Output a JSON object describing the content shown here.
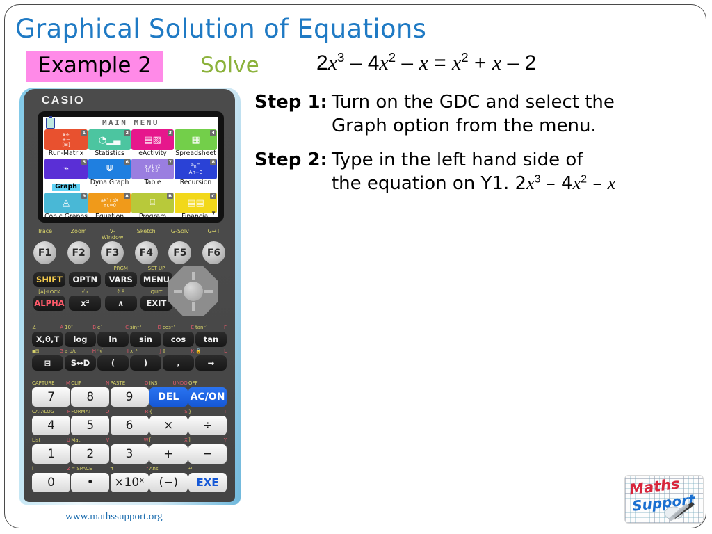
{
  "slide": {
    "title": "Graphical Solution of Equations",
    "example_badge": "Example 2",
    "solve_label": "Solve",
    "website": "www.mathssupport.org",
    "accent_blue": "#1F7AC4",
    "badge_pink": "#FF8AE8",
    "solve_green": "#8CB23C"
  },
  "equation": {
    "full": "2x³ – 4x² – x = x² + x – 2",
    "lhs": "2x³ – 4x² – x",
    "rhs": "x² + x – 2"
  },
  "steps": [
    {
      "key": "Step 1:",
      "line1": "Turn on the GDC and select the",
      "line2": "Graph option from the menu."
    },
    {
      "key": "Step 2:",
      "line1": "Type in the left hand side of",
      "line2": "the equation on Y1. 2x³ – 4x² – x"
    }
  ],
  "calculator": {
    "brand": "CASIO",
    "screen": {
      "title": "MAIN MENU",
      "battery_icon": "battery-icon",
      "scroll_arrow": "▼",
      "menu_items": [
        {
          "num": "1",
          "label": "Run-Matrix",
          "color": "#e8512f",
          "icon": "matrix-icon",
          "selected": false
        },
        {
          "num": "2",
          "label": "Statistics",
          "color": "#4cc5a0",
          "icon": "statistics-icon",
          "selected": false
        },
        {
          "num": "3",
          "label": "eActivity",
          "color": "#e6178c",
          "icon": "eactivity-icon",
          "selected": false
        },
        {
          "num": "4",
          "label": "Spreadsheet",
          "color": "#73cf4a",
          "icon": "spreadsheet-icon",
          "selected": false
        },
        {
          "num": "5",
          "label": "Graph",
          "color": "#5a2fd6",
          "icon": "graph-icon",
          "selected": true
        },
        {
          "num": "6",
          "label": "Dyna Graph",
          "color": "#1f7fe0",
          "icon": "dyna-graph-icon",
          "selected": false
        },
        {
          "num": "7",
          "label": "Table",
          "color": "#9a7ee0",
          "icon": "table-icon",
          "selected": false
        },
        {
          "num": "8",
          "label": "Recursion",
          "color": "#2a42d6",
          "icon": "recursion-icon",
          "selected": false
        },
        {
          "num": "9",
          "label": "Conic Graphs",
          "color": "#49b8d6",
          "icon": "conic-icon",
          "selected": false
        },
        {
          "num": "A",
          "label": "Equation",
          "color": "#f09a1a",
          "icon": "equation-icon",
          "selected": false
        },
        {
          "num": "B",
          "label": "Program",
          "color": "#b8c93a",
          "icon": "program-icon",
          "selected": false
        },
        {
          "num": "C",
          "label": "Financial",
          "color": "#f2d81a",
          "icon": "financial-icon",
          "selected": false
        }
      ],
      "tile_glyphs": {
        "matrix": "×÷\n+−",
        "statistics": "◔",
        "eactivity": "▤",
        "spreadsheet": "▦",
        "graph": "∿",
        "dyna_graph": "⋓",
        "table": "⌗",
        "recursion": "an=\nAn+B",
        "conic": "◬",
        "equation": "aX²+bX\n+c=0",
        "program": "⛭",
        "financial": "💵"
      }
    },
    "fkeys": [
      {
        "label": "Trace",
        "key": "F1"
      },
      {
        "label": "Zoom",
        "key": "F2"
      },
      {
        "label": "V-Window",
        "key": "F3"
      },
      {
        "label": "Sketch",
        "key": "F4"
      },
      {
        "label": "G-Solv",
        "key": "F5"
      },
      {
        "label": "G↔T",
        "key": "F6"
      }
    ],
    "row_shift": [
      {
        "top": "",
        "key": "SHIFT"
      },
      {
        "top": "",
        "key": "OPTN"
      },
      {
        "top": "PRGM",
        "key": "VARS"
      },
      {
        "top": "SET UP",
        "key": "MENU"
      }
    ],
    "row_alpha": [
      {
        "top": "[A]-LOCK",
        "key": "ALPHA"
      },
      {
        "top": "√  r",
        "key": "x²"
      },
      {
        "top": "∛  θ",
        "key": "∧"
      },
      {
        "top": "QUIT",
        "key": "EXIT"
      }
    ],
    "row_trig": [
      {
        "tl": "∠",
        "tr": "A",
        "key": "X,θ,T"
      },
      {
        "tl": "10ˣ",
        "tr": "B",
        "key": "log"
      },
      {
        "tl": "e˟",
        "tr": "C",
        "key": "ln"
      },
      {
        "tl": "sin⁻¹",
        "tr": "D",
        "key": "sin"
      },
      {
        "tl": "cos⁻¹",
        "tr": "E",
        "key": "cos"
      },
      {
        "tl": "tan⁻¹",
        "tr": "F",
        "key": "tan"
      }
    ],
    "row_frac": [
      {
        "tl": "▪⊟",
        "tr": "G",
        "key": "⊟"
      },
      {
        "tl": "a b/c",
        "tr": "H",
        "key": "S↔D"
      },
      {
        "tl": "ˣ√",
        "tr": "I",
        "key": "("
      },
      {
        "tl": "x⁻¹",
        "tr": "J",
        "key": ")"
      },
      {
        "tl": "⌸",
        "tr": "K",
        "key": ","
      },
      {
        "tl": "🔒",
        "tr": "L",
        "key": "→"
      }
    ],
    "numpad": [
      [
        {
          "tl": "CAPTURE",
          "tr": "M",
          "key": "7",
          "style": "white"
        },
        {
          "tl": "CLIP",
          "tr": "N",
          "key": "8",
          "style": "white"
        },
        {
          "tl": "PASTE",
          "tr": "O",
          "key": "9",
          "style": "white"
        },
        {
          "tl": "INS",
          "tr": "UNDO",
          "key": "DEL",
          "style": "blue"
        },
        {
          "tl": "OFF",
          "tr": "",
          "key": "AC/ON",
          "style": "blue"
        }
      ],
      [
        {
          "tl": "CATALOG",
          "tr": "P",
          "key": "4",
          "style": "white"
        },
        {
          "tl": "FORMAT",
          "tr": "Q",
          "key": "5",
          "style": "white"
        },
        {
          "tl": "",
          "tr": "R",
          "key": "6",
          "style": "white"
        },
        {
          "tl": "{",
          "tr": "S",
          "key": "×",
          "style": "white"
        },
        {
          "tl": "}",
          "tr": "T",
          "key": "÷",
          "style": "white"
        }
      ],
      [
        {
          "tl": "List",
          "tr": "U",
          "key": "1",
          "style": "white"
        },
        {
          "tl": "Mat",
          "tr": "V",
          "key": "2",
          "style": "white"
        },
        {
          "tl": "",
          "tr": "W",
          "key": "3",
          "style": "white"
        },
        {
          "tl": "[",
          "tr": "X",
          "key": "+",
          "style": "white"
        },
        {
          "tl": "]",
          "tr": "Y",
          "key": "−",
          "style": "white"
        }
      ],
      [
        {
          "tl": "i",
          "tr": "Z",
          "key": "0",
          "style": "white"
        },
        {
          "tl": "=  SPACE",
          "tr": "",
          "key": "•",
          "style": "white"
        },
        {
          "tl": "π",
          "tr": "\"",
          "key": "×10ˣ",
          "style": "white"
        },
        {
          "tl": "Ans",
          "tr": "",
          "key": "(−)",
          "style": "white"
        },
        {
          "tl": "↵",
          "tr": "",
          "key": "EXE",
          "style": "exe"
        }
      ]
    ],
    "dpad": "direction-pad"
  },
  "logo": {
    "maths": "Maths",
    "support": "Support"
  }
}
